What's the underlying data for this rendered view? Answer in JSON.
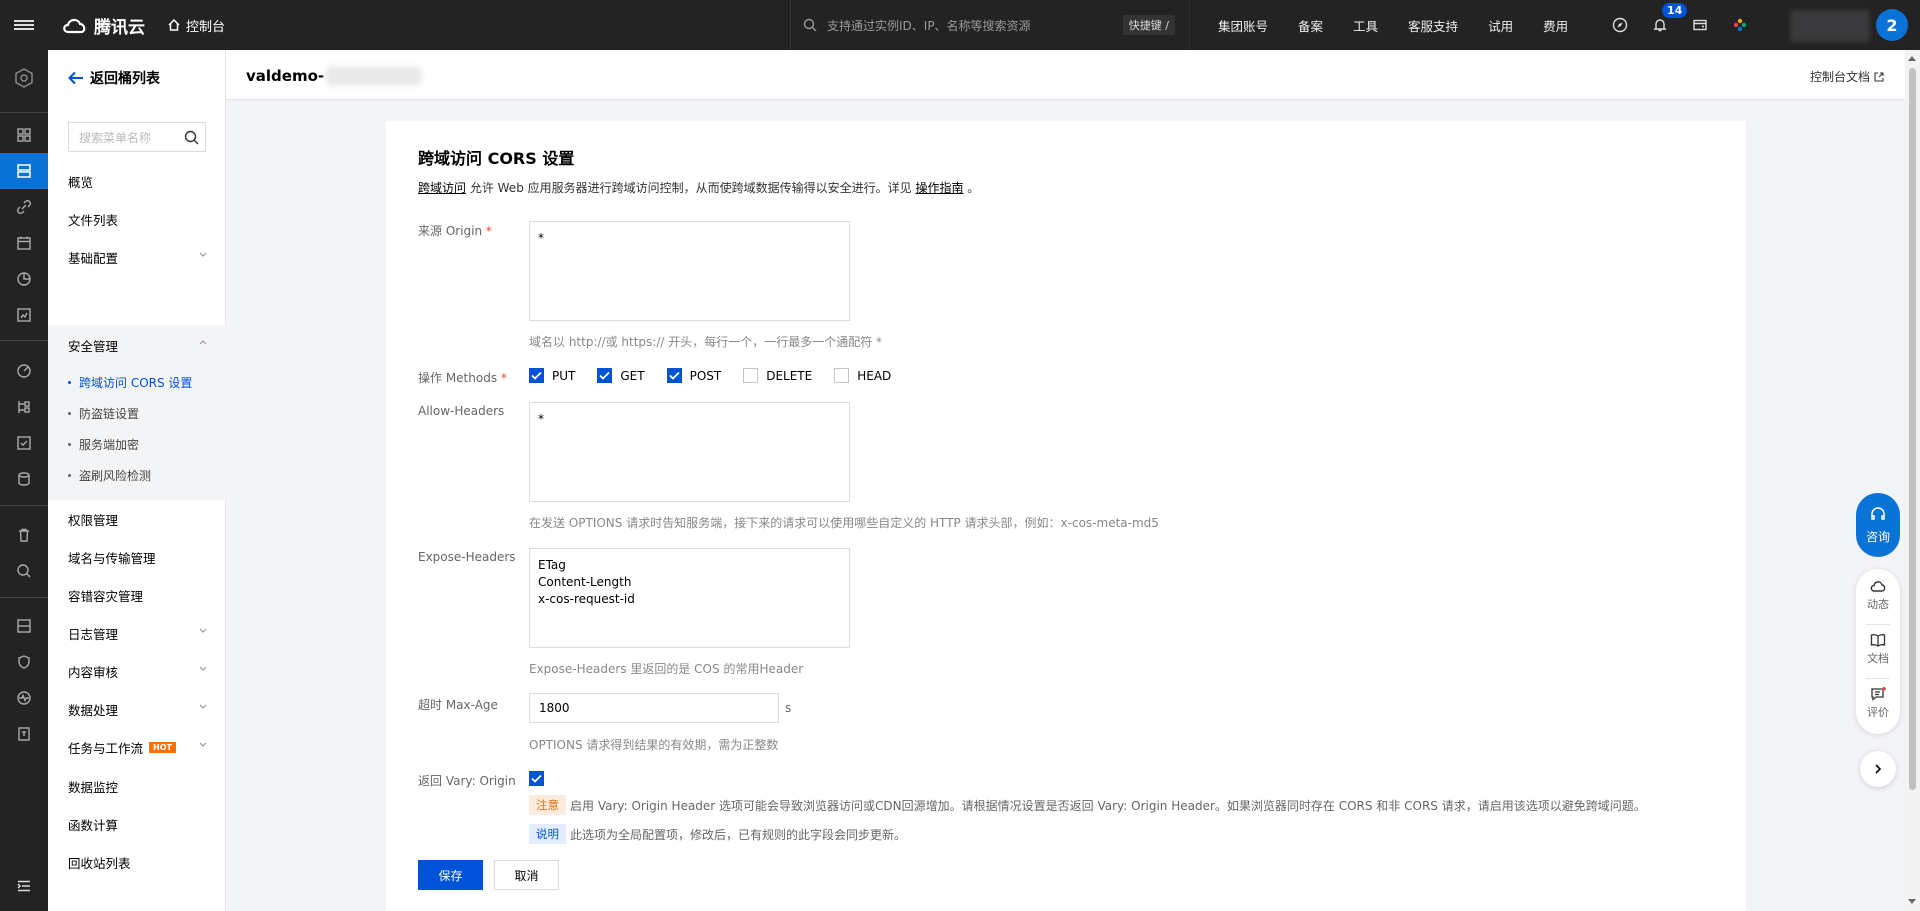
{
  "topbar": {
    "brand": "腾讯云",
    "console": "控制台",
    "search_placeholder": "支持通过实例ID、IP、名称等搜索资源",
    "shortcut": "快捷键 /",
    "nav": [
      "集团账号",
      "备案",
      "工具",
      "客服支持",
      "试用",
      "费用"
    ],
    "notification_count": "14",
    "avatar_initial": "2"
  },
  "sidebar": {
    "back_label": "返回桶列表",
    "search_placeholder": "搜索菜单名称",
    "items": {
      "overview": "概览",
      "files": "文件列表",
      "basic": "基础配置",
      "security": "安全管理",
      "permissions": "权限管理",
      "domain": "域名与传输管理",
      "fault": "容错容灾管理",
      "logs": "日志管理",
      "audit": "内容审核",
      "data": "数据处理",
      "tasks": "任务与工作流",
      "monitor": "数据监控",
      "functions": "函数计算",
      "recycle": "回收站列表"
    },
    "security_sub": [
      "跨域访问 CORS 设置",
      "防盗链设置",
      "服务端加密",
      "盗刷风险检测"
    ],
    "hot_badge": "HOT"
  },
  "header": {
    "bucket_prefix": "valdemo-",
    "docs_link": "控制台文档"
  },
  "form": {
    "title": "跨域访问 CORS 设置",
    "desc_link1": "跨域访问",
    "desc_text": " 允许 Web 应用服务器进行跨域访问控制，从而使跨域数据传输得以安全进行。详见 ",
    "desc_link2": "操作指南",
    "desc_end": " 。",
    "origin_label": "来源 Origin",
    "origin_value": "*",
    "origin_hint": "域名以 http://或 https:// 开头，每行一个，一行最多一个通配符 *",
    "methods_label": "操作 Methods",
    "methods": [
      {
        "label": "PUT",
        "checked": true
      },
      {
        "label": "GET",
        "checked": true
      },
      {
        "label": "POST",
        "checked": true
      },
      {
        "label": "DELETE",
        "checked": false
      },
      {
        "label": "HEAD",
        "checked": false
      }
    ],
    "allow_headers_label": "Allow-Headers",
    "allow_headers_value": "*",
    "allow_headers_hint": "在发送 OPTIONS 请求时告知服务端，接下来的请求可以使用哪些自定义的 HTTP 请求头部，例如：x-cos-meta-md5",
    "expose_headers_label": "Expose-Headers",
    "expose_headers_value": "ETag\nContent-Length\nx-cos-request-id",
    "expose_headers_hint": "Expose-Headers 里返回的是 COS 的常用Header",
    "maxage_label": "超时 Max-Age",
    "maxage_value": "1800",
    "maxage_unit": "s",
    "maxage_hint": "OPTIONS 请求得到结果的有效期，需为正整数",
    "vary_label": "返回 Vary: Origin",
    "vary_checked": true,
    "warn_tag": "注意",
    "warn_text": "启用 Vary: Origin Header 选项可能会导致浏览器访问或CDN回源增加。请根据情况设置是否返回 Vary: Origin Header。如果浏览器同时存在 CORS 和非 CORS 请求，请启用该选项以避免跨域问题。",
    "info_tag": "说明",
    "info_text": "此选项为全局配置项，修改后，已有规则的此字段会同步更新。",
    "save": "保存",
    "cancel": "取消"
  },
  "float": {
    "consult": "咨询",
    "activity": "动态",
    "docs": "文档",
    "rate": "评价"
  },
  "colors": {
    "brand": "#0052d9",
    "dark": "#232324",
    "accent": "#0a73d8"
  }
}
